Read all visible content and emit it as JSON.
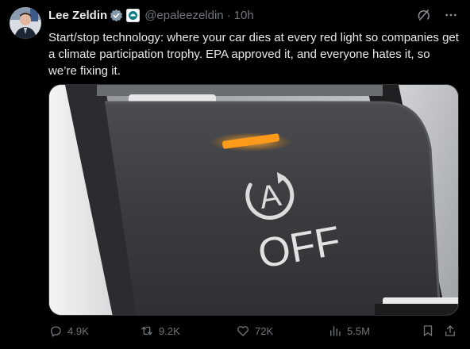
{
  "author": {
    "name": "Lee Zeldin",
    "handle": "@epaleezeldin",
    "separator": "·",
    "time": "10h",
    "badge_color": "#829aab",
    "avatar_icon": "avatar-photo"
  },
  "tweet": {
    "text": "Start/stop technology: where your car dies at every red light so companies get a climate participation trophy. EPA approved it, and everyone hates it, so we’re fixing it."
  },
  "media": {
    "button_label": "OFF",
    "indicator_color": "#ff9a1a"
  },
  "actions": {
    "replies": "4.9K",
    "reposts": "9.2K",
    "likes": "72K",
    "views": "5.5M"
  },
  "icons": {
    "grok": "grok-icon",
    "more": "more-icon",
    "reply": "reply-icon",
    "repost": "repost-icon",
    "like": "heart-icon",
    "views": "views-icon",
    "bookmark": "bookmark-icon",
    "share": "share-icon"
  }
}
